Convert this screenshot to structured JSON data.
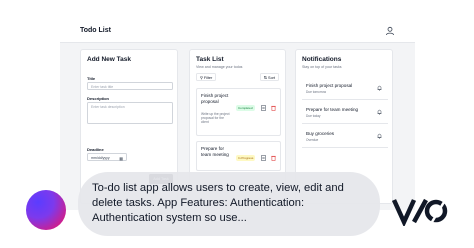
{
  "app": {
    "title": "Todo List"
  },
  "add_task": {
    "heading": "Add New Task",
    "title_label": "Title",
    "title_placeholder": "Enter task title",
    "desc_label": "Description",
    "desc_placeholder": "Enter task description",
    "deadline_label": "Deadline",
    "deadline_placeholder": "mm/dd/yyyy",
    "button": "Add Task"
  },
  "task_list": {
    "heading": "Task List",
    "subtitle": "View and manage your todos",
    "filter": "Filter",
    "sort": "Sort",
    "tasks": [
      {
        "title": "Finish project proposal",
        "desc": "Write up the project proposal for the client",
        "status": "Completed"
      },
      {
        "title": "Prepare for team meeting",
        "desc": "",
        "status": "In Progress"
      }
    ]
  },
  "notifications": {
    "heading": "Notifications",
    "subtitle": "Stay on top of your tasks",
    "items": [
      {
        "title": "Finish project proposal",
        "time": "Due tomorrow"
      },
      {
        "title": "Prepare for team meeting",
        "time": "Due today"
      },
      {
        "title": "Buy groceries",
        "time": "Overdue"
      }
    ]
  },
  "overlay": {
    "text": "To-do list app allows users to create, view, edit and delete tasks. App Features: Authentication: Authentication system so use..."
  },
  "colors": {
    "accent": "#111827",
    "completed": "#15803d",
    "in_progress": "#a16207"
  },
  "icons": [
    "user-icon",
    "filter-icon",
    "sort-icon",
    "edit-icon",
    "delete-icon",
    "bell-icon",
    "calendar-icon"
  ]
}
